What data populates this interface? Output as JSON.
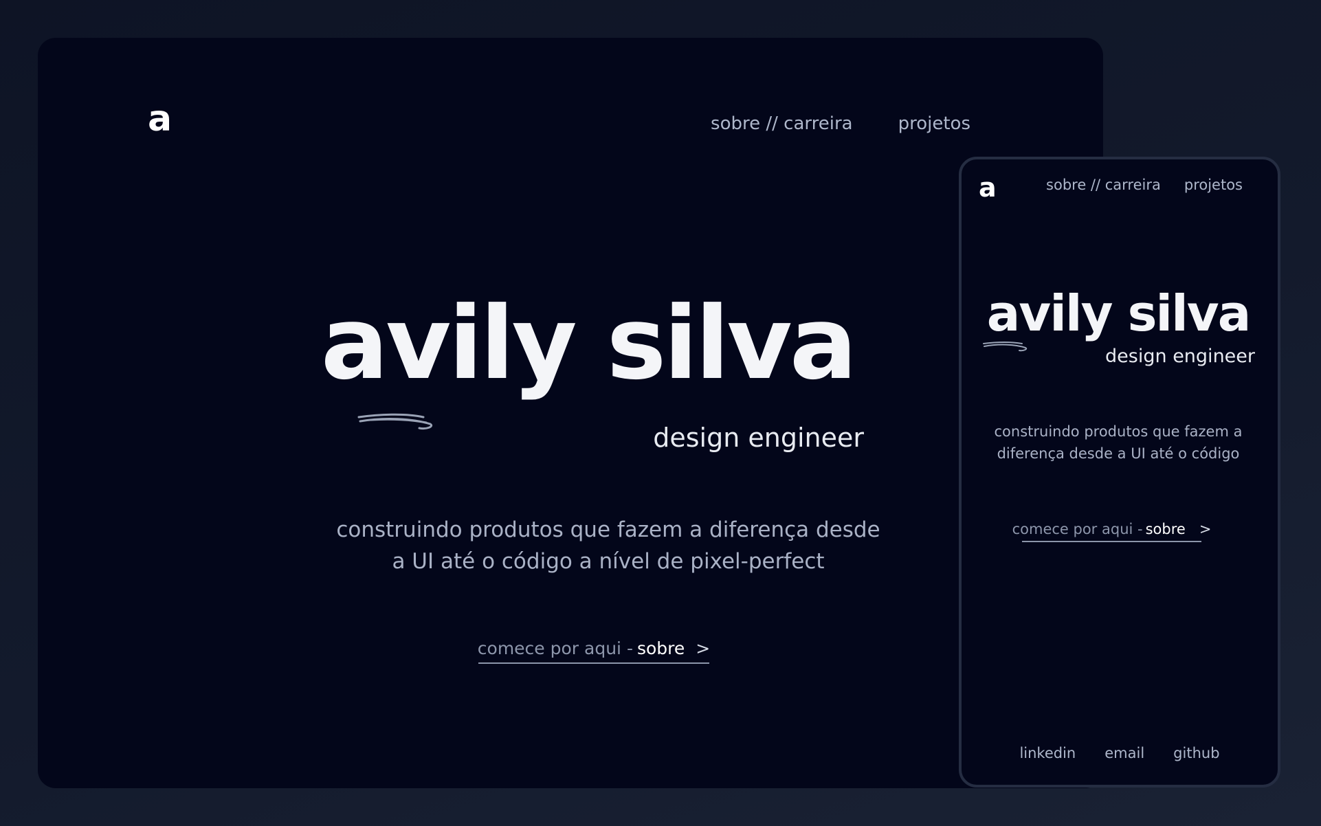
{
  "logo": "a",
  "nav": {
    "about": "sobre // carreira",
    "projects": "projetos"
  },
  "hero": {
    "name": "avily silva",
    "role": "design engineer",
    "tagline_desktop": "construindo produtos que fazem  a diferença desde a UI até o código a nível de pixel-perfect",
    "tagline_mobile": "construindo produtos que fazem  a diferença desde a UI até o código"
  },
  "cta": {
    "prefix": "comece por aqui -",
    "link": "sobre",
    "chevron": ">"
  },
  "footer": {
    "linkedin": "linkedin",
    "email": "email",
    "github": "github"
  },
  "colors": {
    "page_background": "#131a2c",
    "card_background": "#03061a",
    "text_primary": "#ffffff",
    "text_muted": "#aab2c6",
    "device_border": "#252d42"
  }
}
